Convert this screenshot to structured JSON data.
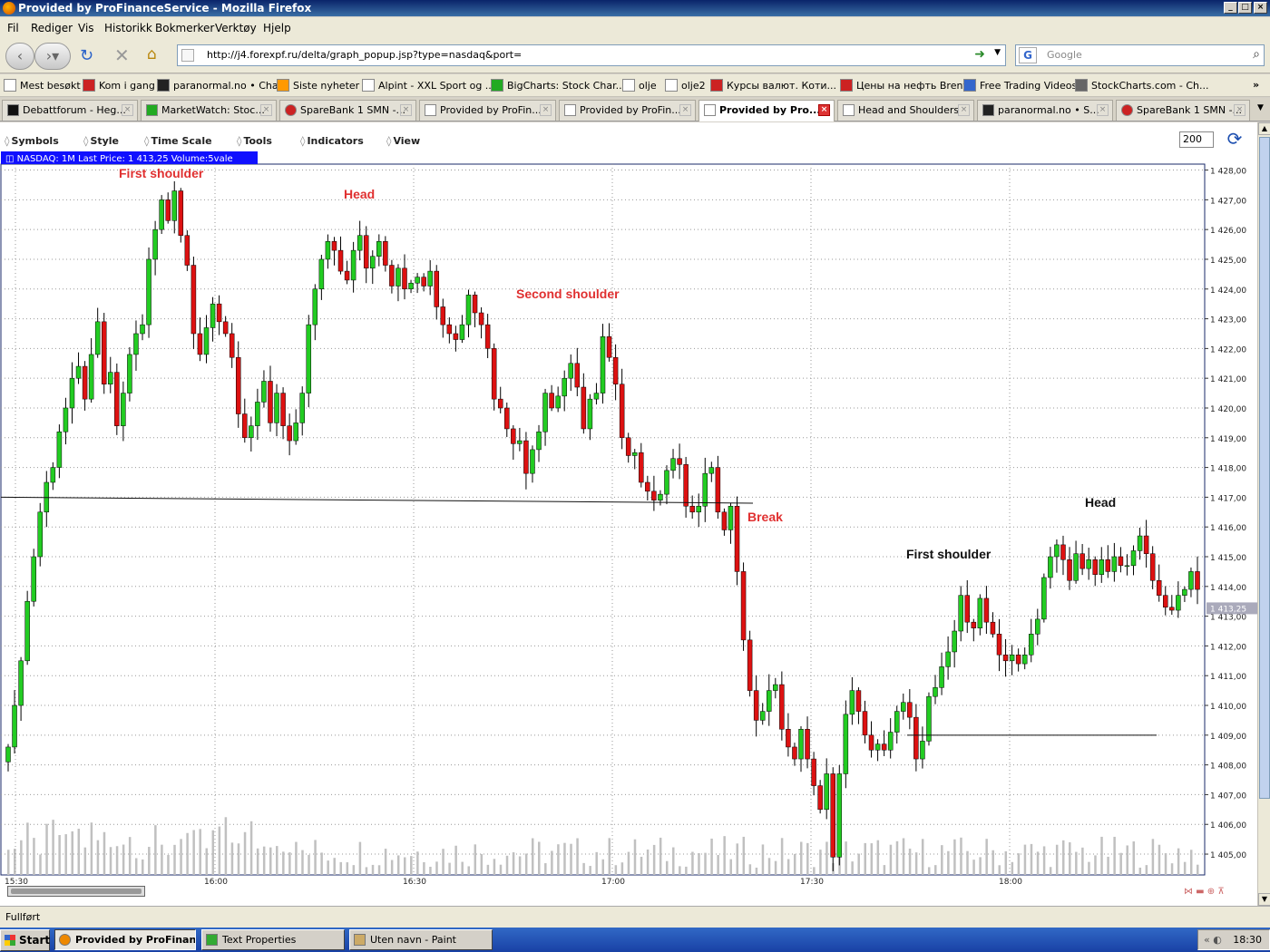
{
  "window": {
    "title": "Provided by ProFinanceService - Mozilla Firefox"
  },
  "menu": [
    "Fil",
    "Rediger",
    "Vis",
    "Historikk",
    "Bokmerker",
    "Verktøy",
    "Hjelp"
  ],
  "navigation": {
    "url": "http://j4.forexpf.ru/delta/graph_popup.jsp?type=nasdaq&port=",
    "search_placeholder": "Google"
  },
  "bookmarks": [
    "Mest besøkt",
    "Kom i gang",
    "paranormal.no • Chat",
    "Siste nyheter",
    "Alpint - XXL Sport og ...",
    "BigCharts: Stock Char...",
    "olje",
    "olje2",
    "Курсы валют. Коти...",
    "Цены на нефть Brent",
    "Free Trading Videos",
    "StockCharts.com - Ch..."
  ],
  "tabs": [
    {
      "label": "Debattforum - Heg...",
      "active": false
    },
    {
      "label": "MarketWatch: Stoc...",
      "active": false
    },
    {
      "label": "SpareBank 1 SMN -...",
      "active": false
    },
    {
      "label": "Provided by ProFin...",
      "active": false
    },
    {
      "label": "Provided by ProFin...",
      "active": false
    },
    {
      "label": "Provided by Pro...",
      "active": true
    },
    {
      "label": "Head and Shoulders",
      "active": false
    },
    {
      "label": "paranormal.no • S...",
      "active": false
    },
    {
      "label": "SpareBank 1 SMN -...",
      "active": false
    }
  ],
  "chart_toolbar": {
    "menus": [
      "Symbols",
      "Style",
      "Time Scale",
      "Tools",
      "Indicators",
      "View"
    ],
    "zoom_value": "200"
  },
  "chart_data": {
    "type": "candlestick",
    "info_label": "NASDAQ: 1M Last Price: 1 413,25 Volume:5vale",
    "last_price_tag": "1 413,25",
    "y_ticks": [
      "1 405,00",
      "1 406,00",
      "1 407,00",
      "1 408,00",
      "1 409,00",
      "1 410,00",
      "1 411,00",
      "1 412,00",
      "1 413,00",
      "1 414,00",
      "1 415,00",
      "1 416,00",
      "1 417,00",
      "1 418,00",
      "1 419,00",
      "1 420,00",
      "1 421,00",
      "1 422,00",
      "1 423,00",
      "1 424,00",
      "1 425,00",
      "1 426,00",
      "1 427,00",
      "1 428,00"
    ],
    "ylim": [
      1404.3,
      1428.2
    ],
    "x_ticks": [
      "15:30",
      "16:00",
      "16:30",
      "17:00",
      "17:30",
      "18:00"
    ],
    "colors": {
      "up": "#22cc22",
      "down": "#dd1111",
      "volume": "#c0c0c0"
    },
    "annotations": [
      {
        "text": "First shoulder",
        "color": "#e03030"
      },
      {
        "text": "Head",
        "color": "#e03030"
      },
      {
        "text": "Second shoulder",
        "color": "#e03030"
      },
      {
        "text": "Break",
        "color": "#e03030"
      },
      {
        "text": "First shoulder",
        "color": "#111111"
      },
      {
        "text": "Head",
        "color": "#111111"
      }
    ],
    "neckline": {
      "start": 1417.0,
      "end": 1416.8
    },
    "right_trendline": {
      "start": 1409.0,
      "end": 1409.0
    },
    "closes": [
      1408.6,
      1410.0,
      1411.5,
      1413.5,
      1415.0,
      1416.5,
      1417.5,
      1418.0,
      1419.2,
      1420.0,
      1421.0,
      1421.4,
      1420.3,
      1421.8,
      1422.9,
      1420.8,
      1421.2,
      1419.4,
      1420.5,
      1421.8,
      1422.5,
      1422.8,
      1425.0,
      1426.0,
      1427.0,
      1426.3,
      1427.3,
      1425.8,
      1424.8,
      1422.5,
      1421.8,
      1422.7,
      1423.5,
      1422.9,
      1422.5,
      1421.7,
      1419.8,
      1419.0,
      1419.4,
      1420.2,
      1420.9,
      1419.5,
      1420.5,
      1419.4,
      1418.9,
      1419.5,
      1420.5,
      1422.8,
      1424.0,
      1425.0,
      1425.6,
      1425.3,
      1424.6,
      1424.3,
      1425.3,
      1425.8,
      1424.7,
      1425.1,
      1425.6,
      1424.8,
      1424.1,
      1424.7,
      1424.0,
      1424.2,
      1424.4,
      1424.1,
      1424.6,
      1423.4,
      1422.8,
      1422.5,
      1422.3,
      1422.8,
      1423.8,
      1423.2,
      1422.8,
      1422.0,
      1420.3,
      1420.0,
      1419.3,
      1418.8,
      1418.9,
      1417.8,
      1418.6,
      1419.2,
      1420.5,
      1420.0,
      1420.4,
      1421.0,
      1421.5,
      1420.7,
      1419.3,
      1420.3,
      1420.5,
      1422.4,
      1421.7,
      1420.8,
      1419.0,
      1418.4,
      1418.5,
      1417.5,
      1417.2,
      1416.9,
      1417.1,
      1417.9,
      1418.3,
      1418.1,
      1416.7,
      1416.5,
      1416.7,
      1417.8,
      1418.0,
      1416.5,
      1415.9,
      1416.7,
      1414.5,
      1412.2,
      1410.5,
      1409.5,
      1409.8,
      1410.5,
      1410.7,
      1409.2,
      1408.6,
      1408.2,
      1409.2,
      1408.2,
      1407.3,
      1406.5,
      1407.7,
      1404.9,
      1407.7,
      1409.7,
      1410.5,
      1409.8,
      1409.0,
      1408.5,
      1408.7,
      1408.5,
      1409.1,
      1409.8,
      1410.1,
      1409.6,
      1408.2,
      1408.8,
      1410.3,
      1410.6,
      1411.3,
      1411.8,
      1412.5,
      1413.7,
      1412.8,
      1412.6,
      1413.6,
      1412.8,
      1412.4,
      1411.7,
      1411.5,
      1411.7,
      1411.4,
      1411.7,
      1412.4,
      1412.9,
      1414.3,
      1415.0,
      1415.4,
      1414.9,
      1414.2,
      1415.1,
      1414.6,
      1414.9,
      1414.4,
      1414.9,
      1414.5,
      1415.0,
      1414.7,
      1414.7,
      1415.2,
      1415.7,
      1415.1,
      1414.2,
      1413.7,
      1413.3,
      1413.2,
      1413.7,
      1413.9,
      1414.5,
      1413.9
    ]
  },
  "status": {
    "text": "Fullført"
  },
  "taskbar": {
    "start": "Start",
    "items": [
      {
        "label": "Provided by ProFinan...",
        "active": true
      },
      {
        "label": "Text Properties",
        "active": false
      },
      {
        "label": "Uten navn - Paint",
        "active": false
      }
    ],
    "clock": "18:30"
  }
}
